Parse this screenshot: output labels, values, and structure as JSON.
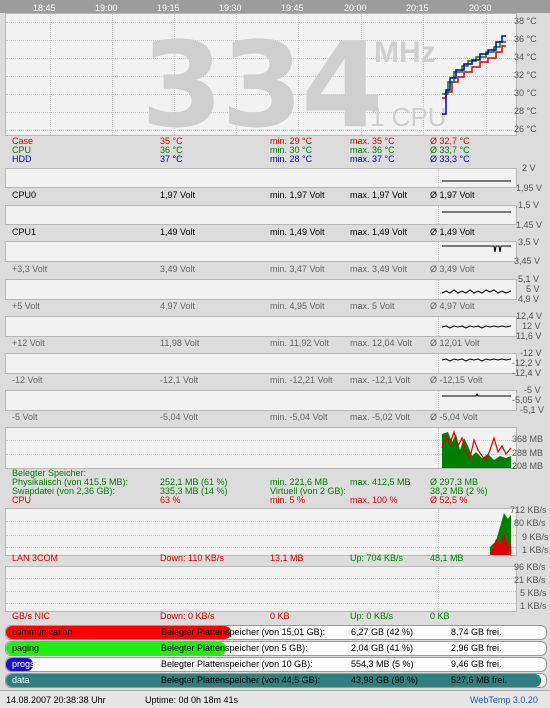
{
  "top_times": [
    "18:45",
    "19:00",
    "19:15",
    "19:30",
    "19:45",
    "20:00",
    "20:15",
    "20:30"
  ],
  "big": {
    "value": "334",
    "unit": "MHz",
    "cpus": "1 CPU"
  },
  "temp_axis": [
    "38 °C",
    "36 °C",
    "34 °C",
    "32 °C",
    "30 °C",
    "28 °C",
    "26 °C"
  ],
  "temps": [
    {
      "name": "Case",
      "cur": "35 °C",
      "min": "min. 29 °C",
      "max": "max. 35 °C",
      "avg": "Ø 32,7 °C",
      "color": "red"
    },
    {
      "name": "CPU",
      "cur": "36 °C",
      "min": "min. 30 °C",
      "max": "max. 36 °C",
      "avg": "Ø 33,7 °C",
      "color": "green"
    },
    {
      "name": "HDD",
      "cur": "37 °C",
      "min": "min. 28 °C",
      "max": "max. 37 °C",
      "avg": "Ø 33,3 °C",
      "color": "blue"
    }
  ],
  "volts": [
    {
      "name": "CPU0",
      "cur": "1,97 Volt",
      "min": "min. 1,97 Volt",
      "max": "max. 1,97 Volt",
      "avg": "Ø 1,97 Volt",
      "axis": [
        "2 V",
        "1,95 V"
      ]
    },
    {
      "name": "CPU1",
      "cur": "1,49 Volt",
      "min": "min. 1,49 Volt",
      "max": "max. 1,49 Volt",
      "avg": "Ø 1,49 Volt",
      "axis": [
        "1,5 V",
        "1,45 V"
      ]
    },
    {
      "name": "+3,3 Volt",
      "cur": "3,49 Volt",
      "min": "min. 3,47 Volt",
      "max": "max. 3,49 Volt",
      "avg": "Ø 3,49 Volt",
      "axis": [
        "3,5 V",
        "3,45 V"
      ]
    },
    {
      "name": "+5 Volt",
      "cur": "4,97 Volt",
      "min": "min. 4,95 Volt",
      "max": "max. 5 Volt",
      "avg": "Ø 4,97 Volt",
      "axis": [
        "5,1 V",
        "5 V",
        "4,9 V"
      ]
    },
    {
      "name": "+12 Volt",
      "cur": "11,98 Volt",
      "min": "min. 11,92 Volt",
      "max": "max. 12,04 Volt",
      "avg": "Ø 12,01 Volt",
      "axis": [
        "12,4 V",
        "12 V",
        "11,6 V"
      ]
    },
    {
      "name": "-12 Volt",
      "cur": "-12,1 Volt",
      "min": "min. -12,21 Volt",
      "max": "max. -12,1 Volt",
      "avg": "Ø -12,15 Volt",
      "axis": [
        "-12 V",
        "-12,2 V",
        "-12,4 V"
      ]
    },
    {
      "name": "-5 Volt",
      "cur": "-5,04 Volt",
      "min": "min. -5,04 Volt",
      "max": "max. -5,02 Volt",
      "avg": "Ø -5,04 Volt",
      "axis": [
        "-5 V",
        "-5,05 V",
        "-5,1 V"
      ]
    }
  ],
  "mem": {
    "axis": [
      "368 MB",
      "288 MB",
      "208 MB"
    ],
    "title": "Belegter Speicher:",
    "phys_label": "Physikalisch (von 415,5 MB):",
    "phys_cur": "252,1 MB (61 %)",
    "phys_min": "min. 221,6 MB",
    "phys_max": "max. 412,5 MB",
    "phys_avg": "Ø 297,3 MB",
    "swap_label": "Swapdatei (von 2,36 GB):",
    "swap_cur": "335,3 MB (14 %)",
    "virt_label": "Virtuell (von 2 GB):",
    "virt_val": "38,2 MB (2 %)",
    "cpu_label": "CPU",
    "cpu_cur": "63 %",
    "cpu_min": "min. 5 %",
    "cpu_max": "max. 100 %",
    "cpu_avg": "Ø 52,5 %"
  },
  "lan": {
    "axis": [
      "712 KB/s",
      "80 KB/s",
      "9 KB/s",
      "1 KB/s"
    ],
    "name": "LAN 3COM",
    "down": "Down: 110 KB/s",
    "down_total": "13,1 MB",
    "up": "Up: 704 KB/s",
    "up_total": "48,1 MB"
  },
  "nic": {
    "axis": [
      "96 KB/s",
      "21 KB/s",
      "5 KB/s",
      "1 KB/s"
    ],
    "name": "GB/s NIC",
    "down": "Down: 0 KB/s",
    "down_total": "0 KB",
    "up": "Up: 0 KB/s",
    "up_total": "0 KB"
  },
  "disks": [
    {
      "name": "communication",
      "label": "Belegter Plattenspeicher (von 15,01 GB):",
      "used": "6,27 GB (42 %)",
      "free": "8,74 GB frei.",
      "color": "#ff0000",
      "fill": 0.42
    },
    {
      "name": "paging",
      "label": "Belegter Plattenspeicher (von 5 GB):",
      "used": "2,04 GB (41 %)",
      "free": "2,96 GB frei.",
      "color": "#22ee11",
      "fill": 0.41
    },
    {
      "name": "progs",
      "label": "Belegter Plattenspeicher (von 10 GB):",
      "used": "554,3 MB (5 %)",
      "free": "9,46 GB frei.",
      "color": "#1a10c8",
      "fill": 0.05
    },
    {
      "name": "data",
      "label": "Belegter Plattenspeicher (von 44,5 GB):",
      "used": "43,98 GB (99 %)",
      "free": "527,6 MB frei.",
      "color": "#2f7f7f",
      "fill": 0.99
    }
  ],
  "footer": {
    "datetime": "14.08.2007 20:38:38 Uhr",
    "uptime": "Uptime: 0d 0h 18m 41s",
    "brand": "WebTemp 3.0.20"
  }
}
